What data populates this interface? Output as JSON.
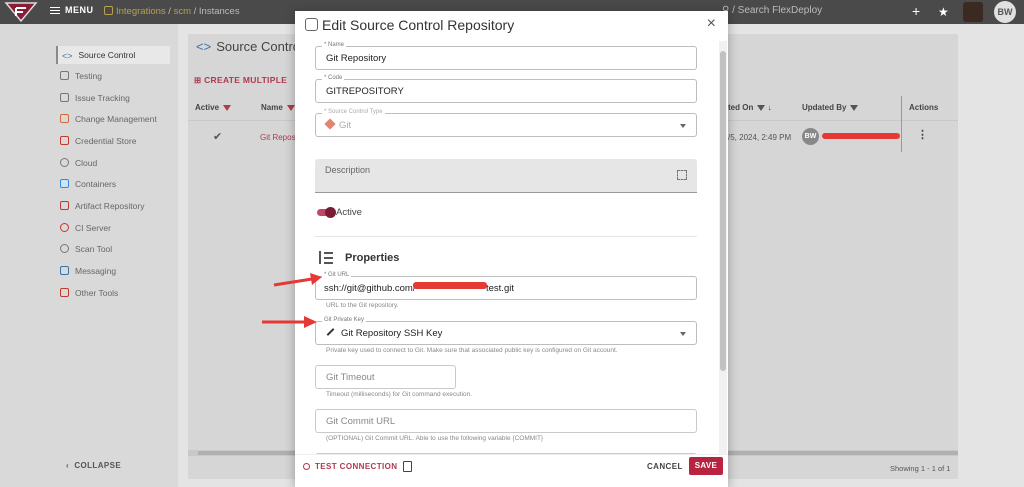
{
  "topbar": {
    "menu_label": "MENU",
    "crumb_1": "Integrations",
    "crumb_sep": "/",
    "crumb_2": "scm",
    "crumb_3": "Instances",
    "search_placeholder": "/ Search FlexDeploy",
    "avatar_initials": "BW"
  },
  "sidebar": {
    "items": [
      {
        "label": "Source Control",
        "icon": "code-icon"
      },
      {
        "label": "Testing",
        "icon": "flask-icon"
      },
      {
        "label": "Issue Tracking",
        "icon": "list-icon"
      },
      {
        "label": "Change Management",
        "icon": "hand-icon"
      },
      {
        "label": "Credential Store",
        "icon": "lock-icon"
      },
      {
        "label": "Cloud",
        "icon": "cloud-icon"
      },
      {
        "label": "Containers",
        "icon": "docker-icon"
      },
      {
        "label": "Artifact Repository",
        "icon": "artifact-icon"
      },
      {
        "label": "CI Server",
        "icon": "ci-icon"
      },
      {
        "label": "Scan Tool",
        "icon": "search-icon"
      },
      {
        "label": "Messaging",
        "icon": "chat-icon"
      },
      {
        "label": "Other Tools",
        "icon": "toolbox-icon"
      }
    ],
    "collapse_label": "COLLAPSE"
  },
  "panel": {
    "title": "Source Control",
    "create_multiple": "CREATE MULTIPLE",
    "columns": {
      "active": "Active",
      "name": "Name",
      "created_on": "ted On",
      "updated_by": "Updated By",
      "actions": "Actions"
    },
    "row": {
      "active_check": "✔",
      "name": "Git Reposi",
      "created_on": "/5, 2024, 2:49 PM",
      "updated_by_initials": "BW"
    },
    "showing": "Showing 1 - 1 of 1"
  },
  "modal": {
    "title": "Edit Source Control Repository",
    "close": "×",
    "name": {
      "label": "* Name",
      "value": "Git Repository"
    },
    "code": {
      "label": "* Code",
      "value": "GITREPOSITORY"
    },
    "type": {
      "label": "* Source Control Type",
      "value": "Git"
    },
    "description_label": "Description",
    "active_label": "Active",
    "properties_title": "Properties",
    "git_url": {
      "label": "* Git URL",
      "value_prefix": "ssh://git@github.com/",
      "value_suffix": "test.git",
      "helper": "URL to the Git repository."
    },
    "private_key": {
      "label": "Git Private Key",
      "value": "Git Repository SSH Key",
      "helper": "Private key used to connect to Git. Make sure that associated public key is configured on Git account."
    },
    "timeout": {
      "placeholder": "Git Timeout",
      "helper": "Timeout (milliseconds) for Git command execution."
    },
    "commit_url": {
      "placeholder": "Git Commit URL",
      "helper": "(OPTIONAL) Git Commit URL. Able to use the following variable {COMMIT}"
    },
    "test_connection": "TEST CONNECTION",
    "cancel": "CANCEL",
    "save": "SAVE"
  },
  "colors": {
    "accent": "#b8243f",
    "redaction": "#e53935",
    "topbar": "#4a4a4a"
  }
}
